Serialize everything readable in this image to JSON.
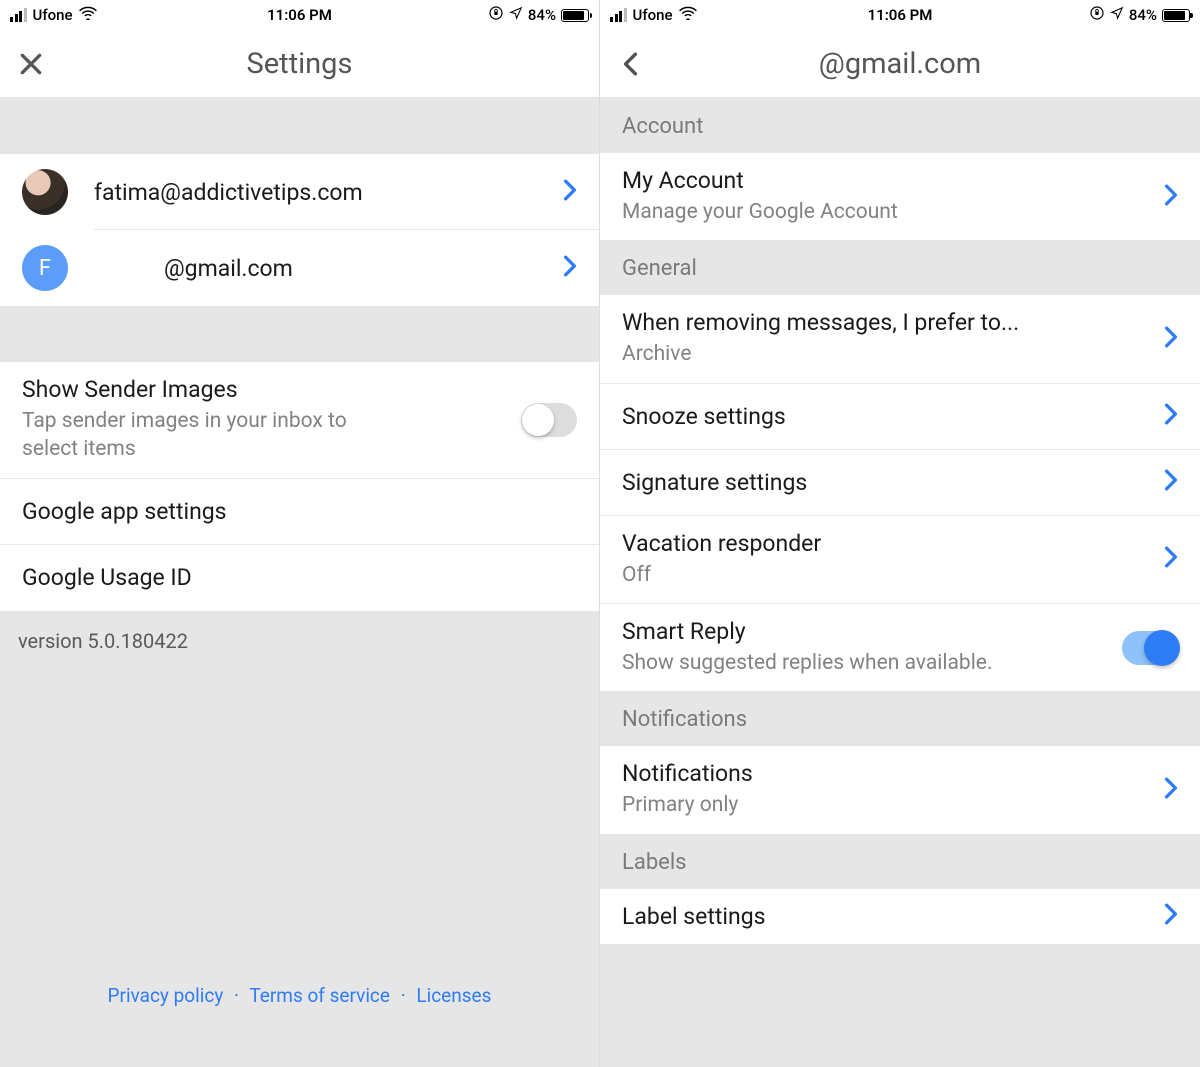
{
  "status": {
    "carrier": "Ufone",
    "time": "11:06 PM",
    "battery_pct": "84%"
  },
  "left": {
    "title": "Settings",
    "accounts": [
      {
        "email": "fatima@addictivetips.com"
      },
      {
        "email": "@gmail.com",
        "initial": "F"
      }
    ],
    "sender_images": {
      "title": "Show Sender Images",
      "sub": "Tap sender images in your inbox to select items"
    },
    "google_app": "Google app settings",
    "usage_id": "Google Usage ID",
    "version": "version 5.0.180422",
    "links": {
      "privacy": "Privacy policy",
      "terms": "Terms of service",
      "licenses": "Licenses"
    }
  },
  "right": {
    "title": "@gmail.com",
    "sections": {
      "account": "Account",
      "general": "General",
      "notifications": "Notifications",
      "labels": "Labels"
    },
    "my_account": {
      "title": "My Account",
      "sub": "Manage your Google Account"
    },
    "remove_pref": {
      "title": "When removing messages, I prefer to...",
      "sub": "Archive"
    },
    "snooze": "Snooze settings",
    "signature": "Signature settings",
    "vacation": {
      "title": "Vacation responder",
      "sub": "Off"
    },
    "smart_reply": {
      "title": "Smart Reply",
      "sub": "Show suggested replies when available."
    },
    "notifications_row": {
      "title": "Notifications",
      "sub": "Primary only"
    },
    "label_settings": "Label settings"
  }
}
